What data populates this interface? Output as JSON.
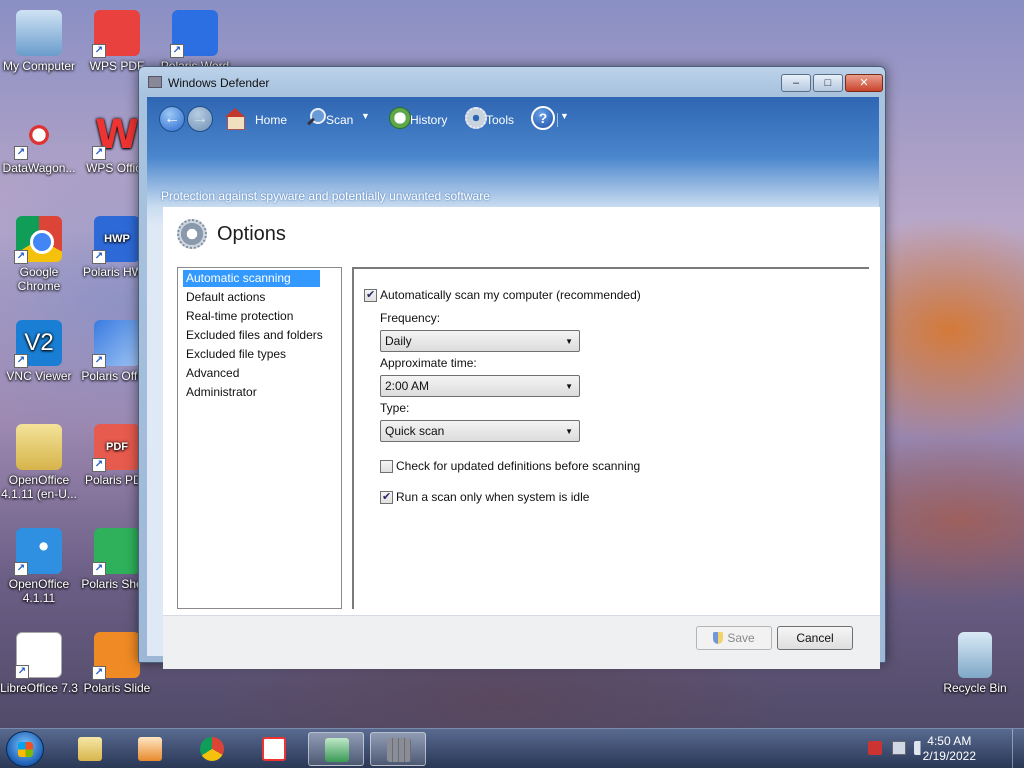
{
  "desktop": {
    "col1": [
      {
        "label": "My Computer",
        "icon": "computer-icon"
      },
      {
        "label": "DataWagon...",
        "icon": "datawagon-icon"
      },
      {
        "label": "Google Chrome",
        "icon": "chrome-icon"
      },
      {
        "label": "VNC Viewer",
        "icon": "vnc-icon"
      },
      {
        "label": "OpenOffice 4.1.11 (en-U...",
        "icon": "folder-icon"
      },
      {
        "label": "OpenOffice 4.1.11",
        "icon": "openoffice-icon"
      },
      {
        "label": "LibreOffice 7.3",
        "icon": "libreoffice-icon"
      }
    ],
    "col2": [
      {
        "label": "WPS PDF",
        "icon": "wps-pdf-icon"
      },
      {
        "label": "WPS Office",
        "icon": "wps-office-icon"
      },
      {
        "label": "Polaris HWP",
        "icon": "hwp-icon"
      },
      {
        "label": "Polaris Office",
        "icon": "polaris-office-icon"
      },
      {
        "label": "Polaris PDF",
        "icon": "pdf-icon"
      },
      {
        "label": "Polaris Sheet",
        "icon": "sheet-icon"
      },
      {
        "label": "Polaris Slide",
        "icon": "slide-icon"
      }
    ],
    "col3": [
      {
        "label": "Polaris Word",
        "icon": "word-icon"
      }
    ],
    "recycle_bin": "Recycle Bin",
    "wps_glyph": "W",
    "hwp_glyph": "HWP",
    "pdf_glyph": "PDF",
    "vnc_glyph": "V2"
  },
  "window": {
    "title": "Windows Defender",
    "controls": {
      "minimize": "–",
      "maximize": "□",
      "close": "✕"
    },
    "toolbar": {
      "back_glyph": "←",
      "forward_glyph": "→",
      "home": "Home",
      "scan": "Scan",
      "history": "History",
      "tools": "Tools",
      "help_glyph": "?",
      "dropdown_glyph": "▼"
    },
    "subtitle": "Protection against spyware and potentially unwanted software",
    "options": {
      "title": "Options",
      "nav": [
        "Automatic scanning",
        "Default actions",
        "Real-time protection",
        "Excluded files and folders",
        "Excluded file types",
        "Advanced",
        "Administrator"
      ],
      "selected_index": 0,
      "auto_scan": {
        "label": "Automatically scan my computer (recommended)",
        "checked": true
      },
      "frequency": {
        "label": "Frequency:",
        "value": "Daily"
      },
      "time": {
        "label": "Approximate time:",
        "value": "2:00 AM"
      },
      "type": {
        "label": "Type:",
        "value": "Quick scan"
      },
      "check_defs": {
        "label": "Check for updated definitions before scanning",
        "checked": false
      },
      "idle_only": {
        "label": "Run a scan only when system is idle",
        "checked": true
      },
      "combo_arrow": "▼",
      "save": "Save",
      "cancel": "Cancel"
    }
  },
  "taskbar": {
    "clock_time": "4:50 AM",
    "clock_date": "2/19/2022"
  }
}
